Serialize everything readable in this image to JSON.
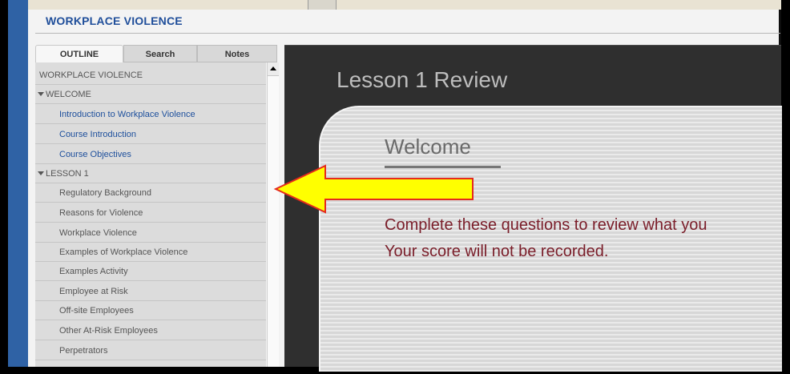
{
  "course": {
    "title": "WORKPLACE VIOLENCE"
  },
  "tabs": [
    {
      "label": "OUTLINE"
    },
    {
      "label": "Search"
    },
    {
      "label": "Notes"
    }
  ],
  "outline": {
    "items": [
      {
        "label": "WORKPLACE VIOLENCE"
      },
      {
        "label": "WELCOME"
      },
      {
        "label": "Introduction to Workplace Violence"
      },
      {
        "label": "Course Introduction"
      },
      {
        "label": "Course Objectives"
      },
      {
        "label": "LESSON 1"
      },
      {
        "label": "Regulatory Background"
      },
      {
        "label": "Reasons for Violence"
      },
      {
        "label": "Workplace Violence"
      },
      {
        "label": "Examples of Workplace Violence"
      },
      {
        "label": "Examples Activity"
      },
      {
        "label": "Employee at Risk"
      },
      {
        "label": "Off-site Employees"
      },
      {
        "label": "Other At-Risk Employees"
      },
      {
        "label": "Perpetrators"
      }
    ]
  },
  "stage": {
    "title": "Lesson 1 Review",
    "heading": "Welcome",
    "message_line1": "Complete these questions to review what you",
    "message_line2": "Your score will not be recorded."
  },
  "colors": {
    "frame_blue": "#2f62a5",
    "link_blue": "#1d4f9c",
    "message_red": "#7a1d29",
    "arrow_yellow": "#ffff00",
    "arrow_outline": "#e52a1d"
  }
}
